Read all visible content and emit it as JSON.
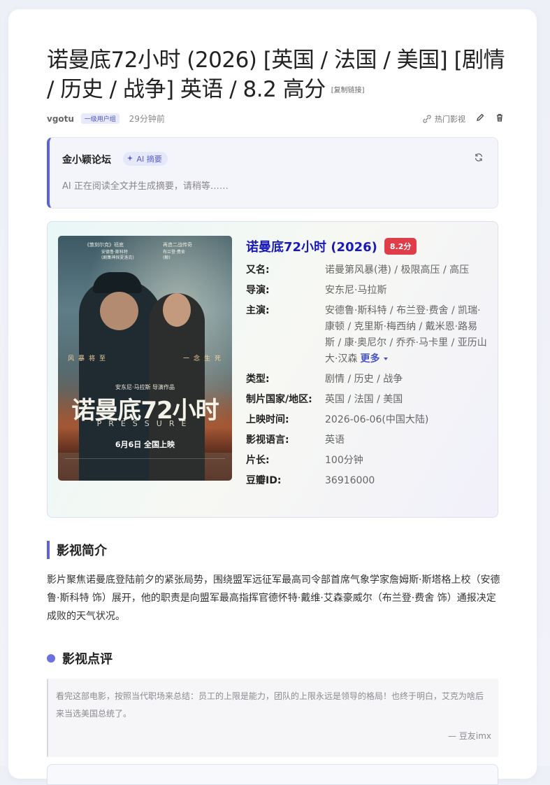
{
  "post": {
    "title": "诺曼底72小时 (2026) [英国 / 法国 / 美国] [剧情 / 历史 / 战争] 英语 / 8.2 高分",
    "copy_link": "[复制链接]",
    "author": "vgotu",
    "user_group": "一级用户组",
    "time": "29分钟前",
    "category": "热门影视",
    "edit_icon": "pencil-icon",
    "delete_icon": "trash-icon"
  },
  "ai_summary": {
    "site": "金小颖论坛",
    "badge": "AI 摘要",
    "status": "AI 正在阅读全文并生成摘要，请稍等……",
    "refresh_icon": "refresh-icon"
  },
  "movie": {
    "title": "诺曼底72小时 (2026)",
    "score": "8.2分",
    "fields": [
      {
        "key": "又名:",
        "value": "诺曼第风暴(港) / 极限高压 / 高压"
      },
      {
        "key": "导演:",
        "value": "安东尼·马拉斯"
      },
      {
        "key": "主演:",
        "value": "安德鲁·斯科特 / 布兰登·费舍 / 凯瑞·康顿 / 克里斯·梅西纳 / 戴米恩·路易斯 / 康·奥尼尔 / 乔乔·马卡里 / 亚历山大·汉森"
      },
      {
        "key": "类型:",
        "value": "剧情 / 历史 / 战争"
      },
      {
        "key": "制片国家/地区:",
        "value": "英国 / 法国 / 美国"
      },
      {
        "key": "上映时间:",
        "value": "2026-06-06(中国大陆)"
      },
      {
        "key": "影视语言:",
        "value": "英语"
      },
      {
        "key": "片长:",
        "value": "100分钟"
      },
      {
        "key": "豆瓣ID:",
        "value": "36916000"
      }
    ],
    "more": "更多",
    "poster": {
      "top_left": "《敦刻尔克》班底",
      "top_right": "再造二战传奇",
      "cast_left": "安德鲁·斯科特",
      "cast_left_sub": "(剧集神探夏洛克)",
      "cast_right": "布兰登·费舍",
      "cast_right_sub": "(鲸)",
      "slogan_left": "风暴将至",
      "slogan_right": "一念生死",
      "director": "安东尼·马拉斯 导演作品",
      "title": "诺曼底72小时",
      "english": "PRESSURE",
      "release": "6月6日 全国上映"
    }
  },
  "synopsis": {
    "heading": "影视简介",
    "text": "影片聚焦诺曼底登陆前夕的紧张局势，围绕盟军远征军最高司令部首席气象学家詹姆斯·斯塔格上校（安德鲁·斯科特 饰）展开，他的职责是向盟军最高指挥官德怀特·戴维·艾森豪威尔（布兰登·费舍 饰）通报决定成败的天气状况。"
  },
  "reviews": {
    "heading": "影视点评",
    "items": [
      {
        "text": "看完这部电影，按照当代职场来总结：员工的上限是能力，团队的上限永远是领导的格局！也终于明白，艾克为啥后来当选美国总统了。",
        "author": "— 豆友imx"
      }
    ]
  }
}
